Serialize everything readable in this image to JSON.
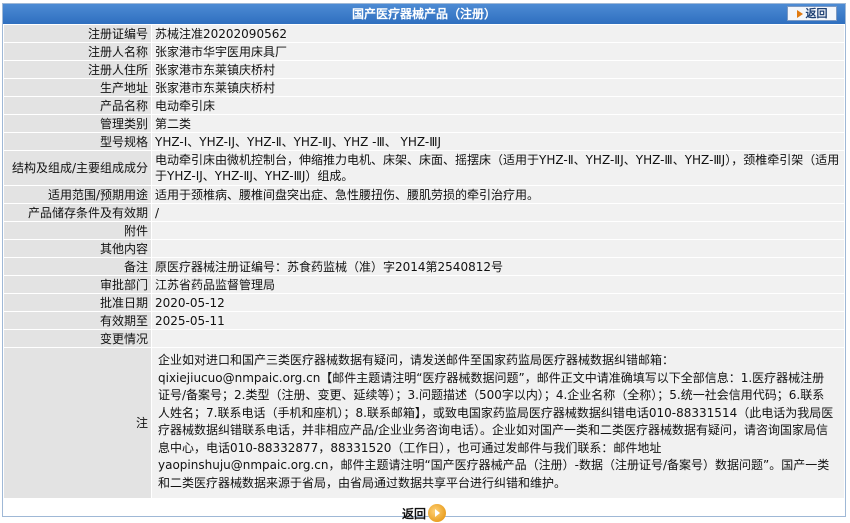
{
  "header": {
    "title": "国产医疗器械产品（注册）",
    "back_label": "返回"
  },
  "rows": [
    {
      "label": "注册证编号",
      "value": "苏械注准20202090562"
    },
    {
      "label": "注册人名称",
      "value": "张家港市华宇医用床具厂"
    },
    {
      "label": "注册人住所",
      "value": "张家港市东莱镇庆桥村"
    },
    {
      "label": "生产地址",
      "value": "张家港市东莱镇庆桥村"
    },
    {
      "label": "产品名称",
      "value": "电动牵引床"
    },
    {
      "label": "管理类别",
      "value": "第二类"
    },
    {
      "label": "型号规格",
      "value": "YHZ-Ⅰ、YHZ-ⅠJ、YHZ-Ⅱ、YHZ-ⅡJ、YHZ -Ⅲ、 YHZ-ⅢJ"
    },
    {
      "label": "结构及组成/主要组成成分",
      "value": "电动牵引床由微机控制台，伸缩推力电机、床架、床面、摇摆床（适用于YHZ-Ⅱ、YHZ-ⅡJ、YHZ-Ⅲ、YHZ-ⅢJ），颈椎牵引架（适用于YHZ-ⅠJ、YHZ-ⅡJ、YHZ-ⅢJ）组成。"
    },
    {
      "label": "适用范围/预期用途",
      "value": "适用于颈椎病、腰椎间盘突出症、急性腰扭伤、腰肌劳损的牵引治疗用。"
    },
    {
      "label": "产品储存条件及有效期",
      "value": "/"
    },
    {
      "label": "附件",
      "value": ""
    },
    {
      "label": "其他内容",
      "value": ""
    },
    {
      "label": "备注",
      "value": "原医疗器械注册证编号：苏食药监械（准）字2014第2540812号"
    },
    {
      "label": "审批部门",
      "value": "江苏省药品监督管理局"
    },
    {
      "label": "批准日期",
      "value": "2020-05-12"
    },
    {
      "label": "有效期至",
      "value": "2025-05-11"
    },
    {
      "label": "变更情况",
      "value": ""
    }
  ],
  "note": {
    "label": "注",
    "text": "企业如对进口和国产三类医疗器械数据有疑问，请发送邮件至国家药监局医疗器械数据纠错邮箱：qixiejiucuo@nmpaic.org.cn【邮件主题请注明“医疗器械数据问题”，邮件正文中请准确填写以下全部信息：1.医疗器械注册证号/备案号；2.类型（注册、变更、延续等）；3.问题描述（500字以内）；4.企业名称（全称）；5.统一社会信用代码；6.联系人姓名；7.联系电话（手机和座机）；8.联系邮箱】，或致电国家药监局医疗器械数据纠错电话010-88331514（此电话为我局医疗器械数据纠错联系电话，并非相应产品/企业业务咨询电话）。企业如对国产一类和二类医疗器械数据有疑问，请咨询国家局信息中心，电话010-88332877，88331520（工作日），也可通过发邮件与我们联系：邮件地址yaopinshuju@nmpaic.org.cn，邮件主题请注明“国产医疗器械产品（注册）-数据（注册证号/备案号）数据问题”。国产一类和二类医疗器械数据来源于省局，由省局通过数据共享平台进行纠错和维护。"
  },
  "footer": {
    "back_label": "返回"
  }
}
